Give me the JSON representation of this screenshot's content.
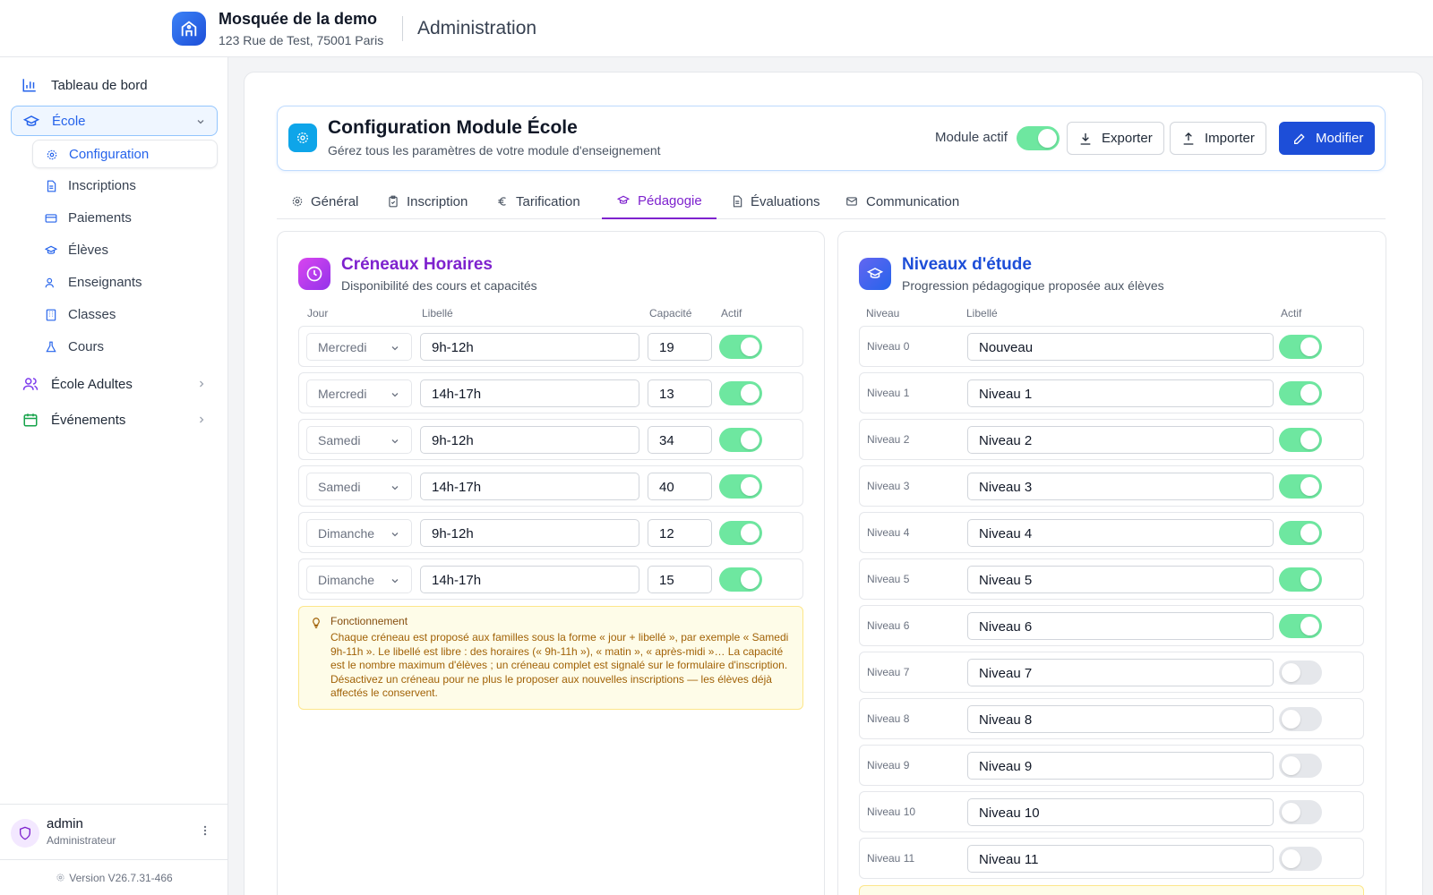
{
  "header": {
    "org_name": "Mosquée de la demo",
    "org_address": "123 Rue de Test, 75001 Paris",
    "section_title": "Administration"
  },
  "sidebar": {
    "items": [
      {
        "label": "Tableau de bord",
        "icon": "bar-chart-icon"
      },
      {
        "label": "École",
        "icon": "graduation-cap-icon",
        "expanded": true
      },
      {
        "label": "École Adultes",
        "icon": "users-icon"
      },
      {
        "label": "Événements",
        "icon": "calendar-icon"
      }
    ],
    "sub_items": [
      {
        "label": "Configuration",
        "icon": "gear-icon",
        "active": true
      },
      {
        "label": "Inscriptions",
        "icon": "document-icon"
      },
      {
        "label": "Paiements",
        "icon": "credit-card-icon"
      },
      {
        "label": "Élèves",
        "icon": "graduation-cap-icon"
      },
      {
        "label": "Enseignants",
        "icon": "users-icon"
      },
      {
        "label": "Classes",
        "icon": "building-icon"
      },
      {
        "label": "Cours",
        "icon": "flask-icon"
      }
    ],
    "user": {
      "name": "admin",
      "role": "Administrateur"
    },
    "version": "Version V26.7.31-466"
  },
  "config": {
    "title": "Configuration Module École",
    "subtitle": "Gérez tous les paramètres de votre module d'enseignement",
    "module_label": "Module actif",
    "module_active": true,
    "export_label": "Exporter",
    "import_label": "Importer",
    "edit_label": "Modifier"
  },
  "tabs": [
    {
      "label": "Général",
      "icon": "gear-icon"
    },
    {
      "label": "Inscription",
      "icon": "clipboard-icon"
    },
    {
      "label": "Tarification",
      "icon": "euro-icon"
    },
    {
      "label": "Pédagogie",
      "icon": "graduation-cap-icon",
      "active": true
    },
    {
      "label": "Évaluations",
      "icon": "document-icon"
    },
    {
      "label": "Communication",
      "icon": "mail-icon"
    }
  ],
  "slots": {
    "title": "Créneaux Horaires",
    "subtitle": "Disponibilité des cours et capacités",
    "columns": {
      "day": "Jour",
      "label": "Libellé",
      "capacity": "Capacité",
      "active": "Actif"
    },
    "rows": [
      {
        "day": "Mercredi",
        "label": "9h-12h",
        "capacity": "19",
        "active": true
      },
      {
        "day": "Mercredi",
        "label": "14h-17h",
        "capacity": "13",
        "active": true
      },
      {
        "day": "Samedi",
        "label": "9h-12h",
        "capacity": "34",
        "active": true
      },
      {
        "day": "Samedi",
        "label": "14h-17h",
        "capacity": "40",
        "active": true
      },
      {
        "day": "Dimanche",
        "label": "9h-12h",
        "capacity": "12",
        "active": true
      },
      {
        "day": "Dimanche",
        "label": "14h-17h",
        "capacity": "15",
        "active": true
      }
    ],
    "info": {
      "title": "Fonctionnement",
      "text": "Chaque créneau est proposé aux familles sous la forme « jour + libellé », par exemple « Samedi 9h-11h ». Le libellé est libre : des horaires (« 9h-11h »), « matin », « après-midi »… La capacité est le nombre maximum d'élèves ; un créneau complet est signalé sur le formulaire d'inscription. Désactivez un créneau pour ne plus le proposer aux nouvelles inscriptions — les élèves déjà affectés le conservent."
    }
  },
  "levels": {
    "title": "Niveaux d'étude",
    "subtitle": "Progression pédagogique proposée aux élèves",
    "columns": {
      "level": "Niveau",
      "label": "Libellé",
      "active": "Actif"
    },
    "rows": [
      {
        "level": "Niveau 0",
        "label": "Nouveau",
        "active": true
      },
      {
        "level": "Niveau 1",
        "label": "Niveau 1",
        "active": true
      },
      {
        "level": "Niveau 2",
        "label": "Niveau 2",
        "active": true
      },
      {
        "level": "Niveau 3",
        "label": "Niveau 3",
        "active": true
      },
      {
        "level": "Niveau 4",
        "label": "Niveau 4",
        "active": true
      },
      {
        "level": "Niveau 5",
        "label": "Niveau 5",
        "active": true
      },
      {
        "level": "Niveau 6",
        "label": "Niveau 6",
        "active": true
      },
      {
        "level": "Niveau 7",
        "label": "Niveau 7",
        "active": false
      },
      {
        "level": "Niveau 8",
        "label": "Niveau 8",
        "active": false
      },
      {
        "level": "Niveau 9",
        "label": "Niveau 9",
        "active": false
      },
      {
        "level": "Niveau 10",
        "label": "Niveau 10",
        "active": false
      },
      {
        "level": "Niveau 11",
        "label": "Niveau 11",
        "active": false
      }
    ]
  },
  "colors": {
    "primary": "#1d4ed8",
    "active_tab": "#7e22ce",
    "toggle_on": "#6ee7a0",
    "slots_title": "#7e22ce",
    "levels_title": "#1d4ed8"
  }
}
